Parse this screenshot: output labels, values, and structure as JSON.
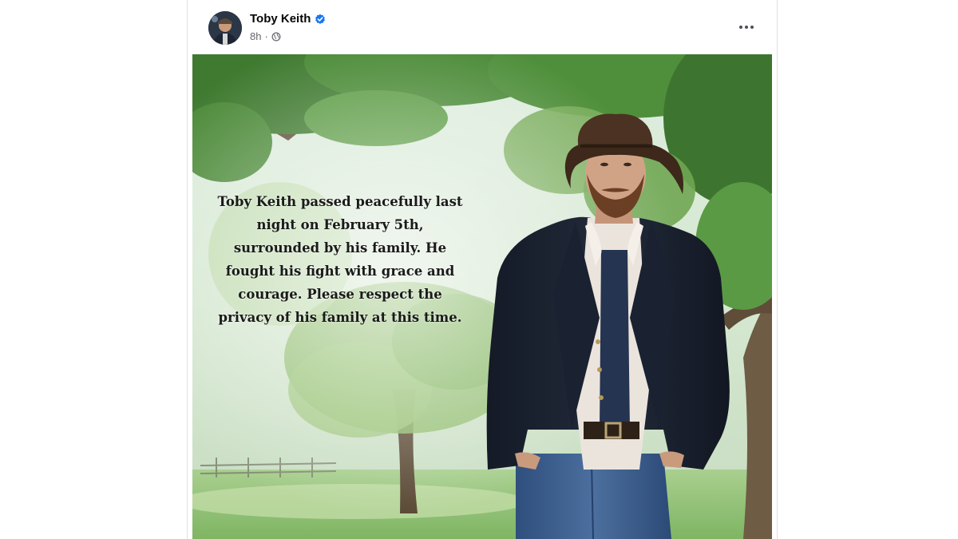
{
  "post": {
    "author": {
      "name": "Toby Keith",
      "verified": true,
      "avatar_icon": "profile-photo"
    },
    "timestamp": "8h",
    "separator": "·",
    "audience_icon": "globe-icon",
    "more_icon": "ellipsis-icon",
    "photo": {
      "description_icon": "cowboy-portrait-photo",
      "overlay_text": "Toby Keith passed peacefully last\nnight on February 5th,\nsurrounded by his family. He\nfought his fight with grace and\ncourage. Please respect the\nprivacy of his family at this time."
    }
  },
  "colors": {
    "verified_blue": "#1877f2",
    "secondary_text": "#65676b",
    "primary_text": "#050505"
  }
}
